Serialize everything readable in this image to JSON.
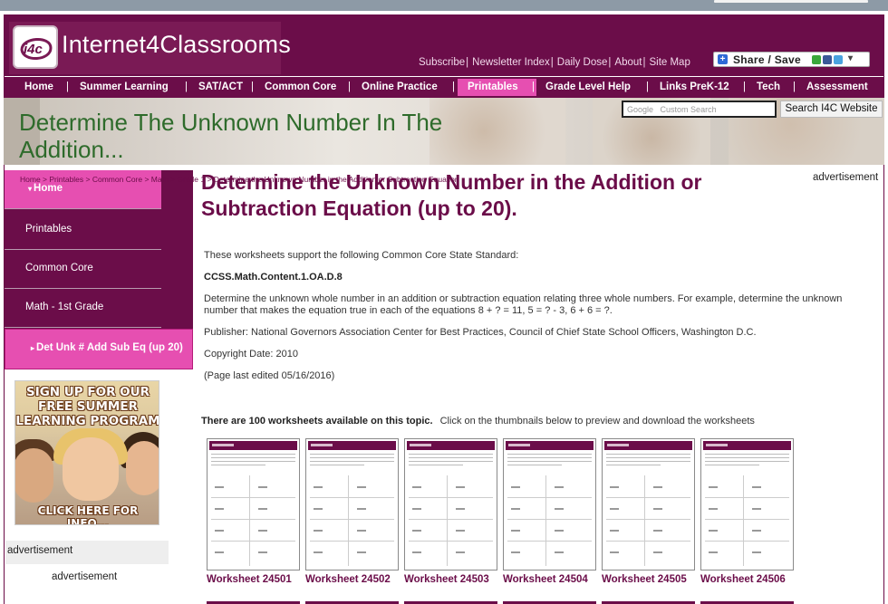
{
  "site": {
    "logo_badge": "i4c",
    "name": "Internet4Classrooms",
    "top_links": [
      "Subscribe",
      "Newsletter Index",
      "Daily Dose",
      "About",
      "Site Map"
    ],
    "share_label": "Share / Save",
    "colors": {
      "brand": "#6b0d49",
      "accent": "#e64fb1",
      "title_green": "#2e6b2b"
    }
  },
  "nav": [
    {
      "label": "Home"
    },
    {
      "label": "Summer Learning"
    },
    {
      "label": "SAT/ACT"
    },
    {
      "label": "Common Core"
    },
    {
      "label": "Online Practice"
    },
    {
      "label": "Printables",
      "active": true
    },
    {
      "label": "Grade Level Help"
    },
    {
      "label": "Links PreK-12"
    },
    {
      "label": "Tech"
    },
    {
      "label": "Assessment"
    }
  ],
  "banner": {
    "title": "Determine The Unknown Number In The Addition..."
  },
  "search": {
    "placeholder": "Custom Search",
    "brand": "Google",
    "button": "Search I4C Website"
  },
  "breadcrumb": "Home > Printables > Common Core > Math > Grade 1 > Determine the Unknown Number in the Addition or Subtraction Equation",
  "sidebar": {
    "items": [
      {
        "label": "Home",
        "highlight": true,
        "icon": "triangle-down-icon"
      },
      {
        "label": "Printables"
      },
      {
        "label": "Common Core"
      },
      {
        "label": "Math - 1st Grade"
      },
      {
        "label": "Det Unk # Add Sub Eq (up 20)",
        "highlight": true,
        "icon": "triangle-right-icon"
      }
    ],
    "promo": {
      "text": "SIGN UP FOR OUR FREE SUMMER LEARNING PROGRAM",
      "cta": "CLICK HERE FOR INFO..."
    },
    "ad_label": "advertisement",
    "ad_label2": "advertisement"
  },
  "main": {
    "ad_label": "advertisement",
    "title": "Determine the Unknown Number in the Addition or Subtraction Equation (up to 20).",
    "intro": "These worksheets support the following Common Core State Standard:",
    "standard": "CCSS.Math.Content.1.OA.D.8",
    "description": "Determine the unknown whole number in an addition or subtraction equation relating three whole numbers. For example, determine the unknown number that makes the equation true in each of the equations 8 + ? = 11, 5 = ? - 3, 6 + 6 = ?.",
    "publisher": "Publisher: National Governors Association Center for Best Practices, Council of Chief State School Officers, Washington D.C.",
    "copyright": "Copyright Date: 2010",
    "edited": "(Page last edited 05/16/2016)",
    "available_bold": "There are 100 worksheets available on this topic.",
    "available_text": "Click on the thumbnails below to preview and download the worksheets",
    "worksheets": [
      {
        "label": "Worksheet 24501"
      },
      {
        "label": "Worksheet 24502"
      },
      {
        "label": "Worksheet 24503"
      },
      {
        "label": "Worksheet 24504"
      },
      {
        "label": "Worksheet 24505"
      },
      {
        "label": "Worksheet 24506"
      }
    ]
  }
}
